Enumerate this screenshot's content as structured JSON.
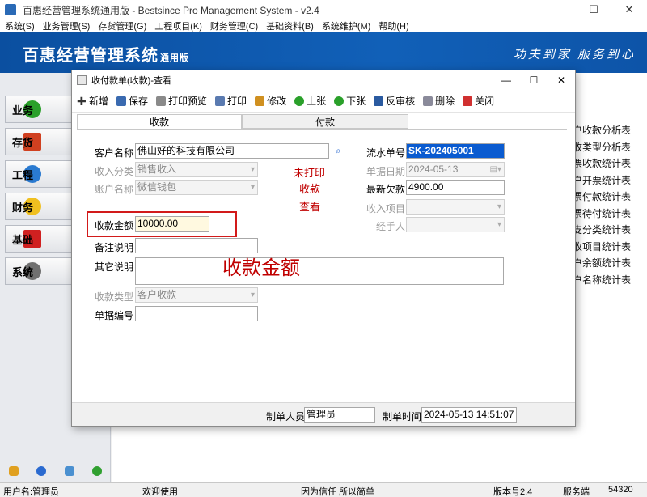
{
  "window": {
    "title": "百惠经营管理系统通用版 - Bestsince Pro Management System - v2.4",
    "controls": {
      "minimize": "—",
      "maximize": "☐",
      "close": "✕"
    }
  },
  "menu": [
    "系统(S)",
    "业务管理(S)",
    "存货管理(G)",
    "工程项目(K)",
    "财务管理(C)",
    "基础资料(B)",
    "系统维护(M)",
    "帮助(H)"
  ],
  "banner": {
    "logo": "百惠经营管理系统",
    "edition": "通用版",
    "slogan": "功夫到家 服务到心"
  },
  "sidebar": {
    "items": [
      {
        "label": "业务",
        "icon": "check-icon",
        "color": "#2aa02a"
      },
      {
        "label": "存货",
        "icon": "house-icon",
        "color": "#d04020"
      },
      {
        "label": "工程",
        "icon": "refresh-icon",
        "color": "#2a7ad0"
      },
      {
        "label": "财务",
        "icon": "star-icon",
        "color": "#f0c020"
      },
      {
        "label": "基础",
        "icon": "book-icon",
        "color": "#d02020"
      },
      {
        "label": "系统",
        "icon": "gear-icon",
        "color": "#707070"
      }
    ]
  },
  "reports": [
    "户收款分析表",
    "收类型分析表",
    "票收款统计表",
    "户开票统计表",
    "票付款统计表",
    "票待付统计表",
    "支分类统计表",
    "收项目统计表",
    "户余额统计表",
    "户名称统计表"
  ],
  "status": {
    "user": "用户名:管理员",
    "welcome": "欢迎使用",
    "motto": "因为信任 所以简单",
    "version": "版本号2.4",
    "server": "服务端",
    "code": "54320"
  },
  "dialog": {
    "title": "收付款单(收款)-查看",
    "controls": {
      "minimize": "—",
      "maximize": "☐",
      "close": "✕"
    },
    "toolbar": {
      "new": "新增",
      "save": "保存",
      "preview": "打印预览",
      "print": "打印",
      "edit": "修改",
      "prev": "上张",
      "next": "下张",
      "unaudit": "反审核",
      "delete": "删除",
      "close": "关闭"
    },
    "tabs": {
      "receive": "收款",
      "pay": "付款"
    },
    "form": {
      "customer_label": "客户名称",
      "customer_value": "佛山好的科技有限公司",
      "income_type_label": "收入分类",
      "income_type_value": "销售收入",
      "account_label": "账户名称",
      "account_value": "微信钱包",
      "amount_label": "收款金额",
      "amount_value": "10000.00",
      "remark_label": "备注说明",
      "remark_value": "",
      "other_label": "其它说明",
      "other_value": "",
      "receipt_type_label": "收款类型",
      "receipt_type_value": "客户收款",
      "doc_no_label": "单据编号",
      "doc_no_value": "",
      "serial_label": "流水单号",
      "serial_value": "SK-202405001",
      "date_label": "单据日期",
      "date_value": "2024-05-13",
      "balance_label": "最新欠款",
      "balance_value": "4900.00",
      "income_item_label": "收入项目",
      "income_item_value": "",
      "handler_label": "经手人",
      "handler_value": ""
    },
    "notes": {
      "unprinted": "未打印",
      "receipt": "收款",
      "view": "查看",
      "annotation": "收款金额"
    },
    "footer": {
      "maker_label": "制单人员",
      "maker_value": "管理员",
      "time_label": "制单时间",
      "time_value": "2024-05-13 14:51:07"
    }
  }
}
